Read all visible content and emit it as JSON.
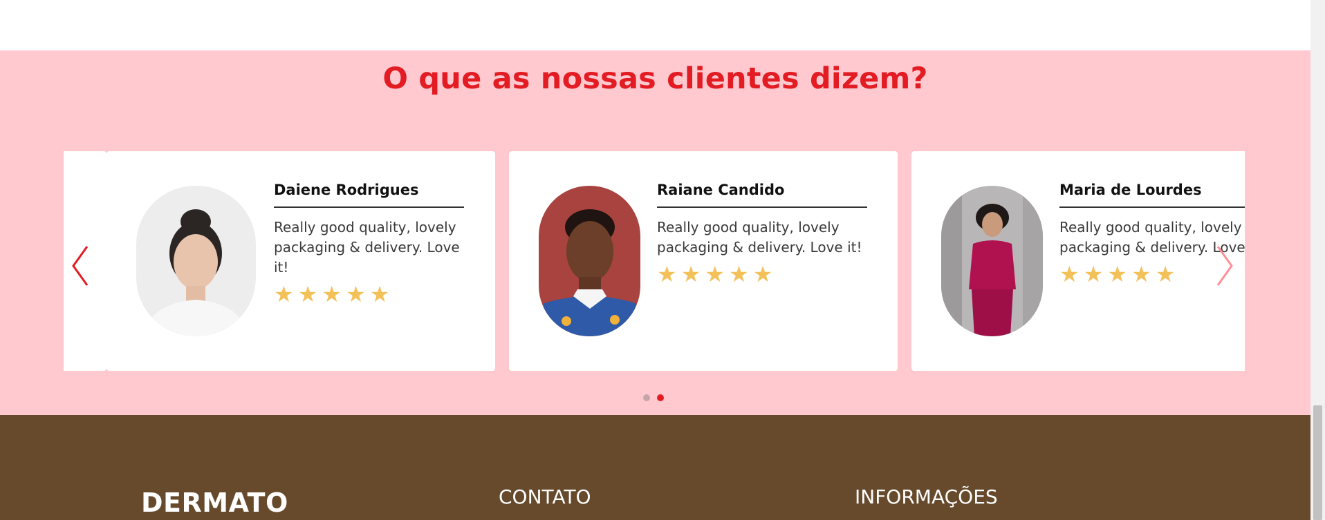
{
  "testimonials": {
    "title": "O que as nossas clientes dizem?",
    "cards": [
      {
        "name": "Daiene Rodrigues",
        "text": "Really good quality, lovely packaging & delivery. Love it!",
        "rating": 5,
        "stars": "★★★★★"
      },
      {
        "name": "Raiane Candido",
        "text": "Really good quality, lovely packaging & delivery. Love it!",
        "rating": 5,
        "stars": "★★★★★"
      },
      {
        "name": "Maria de Lourdes",
        "text": "Really good quality, lovely packaging & delivery. Love it!",
        "rating": 5,
        "stars": "★★★★★"
      }
    ],
    "pagination": {
      "total": 2,
      "active": 2
    },
    "colors": {
      "background": "#ffc9cf",
      "accent": "#e31b23",
      "star": "#f3c15a"
    },
    "icons": {
      "prev": "chevron-left-icon",
      "next": "chevron-right-icon"
    }
  },
  "footer": {
    "brand": "DERMATO",
    "columns": [
      "CONTATO",
      "INFORMAÇÕES"
    ],
    "background": "#674a2c"
  }
}
